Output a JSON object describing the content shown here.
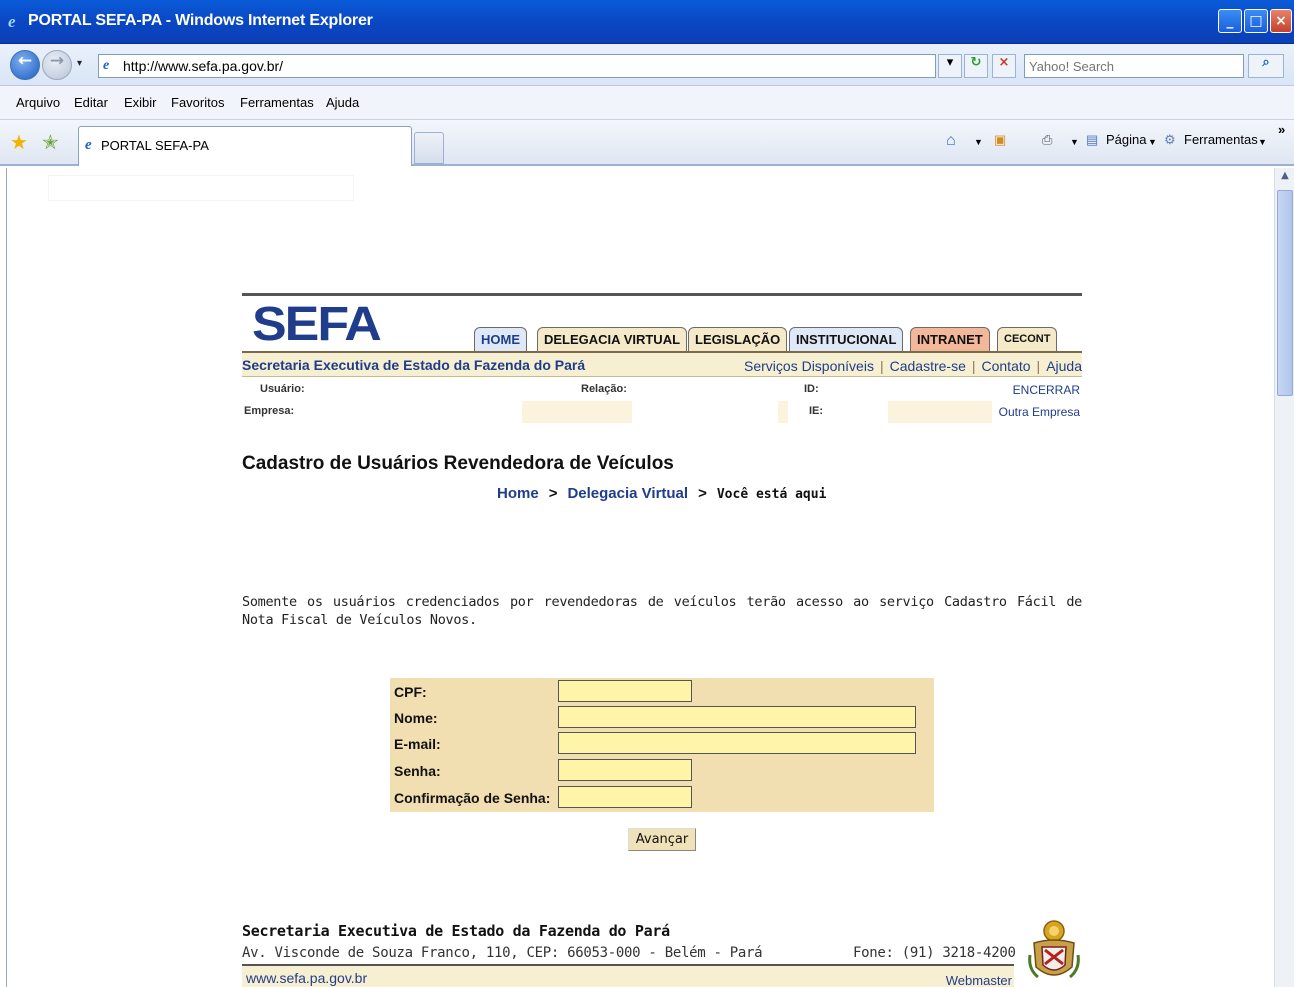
{
  "window": {
    "title": "PORTAL SEFA-PA - Windows Internet Explorer",
    "controls": {
      "minimize": "_",
      "maximize": "□",
      "close": "×"
    }
  },
  "address_bar": {
    "url": "http://www.sefa.pa.gov.br/",
    "search_placeholder": "Yahoo! Search",
    "dropdown_glyph": "▾",
    "refresh_glyph": "↻",
    "stop_glyph": "×",
    "search_glyph": "⌕"
  },
  "menu": [
    "Arquivo",
    "Editar",
    "Exibir",
    "Favoritos",
    "Ferramentas",
    "Ajuda"
  ],
  "favorites_bar": {
    "tab_title": "PORTAL SEFA-PA",
    "commands": {
      "page": "Página",
      "tools": "Ferramentas",
      "more": "»"
    }
  },
  "site": {
    "logo": "SEFA",
    "nav_tabs": [
      "HOME",
      "DELEGACIA VIRTUAL",
      "LEGISLAÇÃO",
      "INSTITUCIONAL",
      "INTRANET",
      "CECONT"
    ],
    "agency": "Secretaria Executiva de Estado da Fazenda do Pará",
    "header_links": [
      "Serviços Disponíveis",
      "Cadastre-se",
      "Contato",
      "Ajuda"
    ],
    "info": {
      "usuario_label": "Usuário:",
      "relacao_label": "Relação:",
      "id_label": "ID:",
      "encerrar": "ENCERRAR",
      "empresa_label": "Empresa:",
      "ie_label": "IE:",
      "outra_empresa": "Outra Empresa"
    },
    "page_title": "Cadastro de Usuários Revendedora de Veículos",
    "breadcrumb": {
      "home": "Home",
      "sep": ">",
      "delegacia": "Delegacia Virtual",
      "current": "Você está aqui"
    },
    "notice": "Somente os usuários credenciados por revendedoras de veículos terão acesso ao serviço Cadastro Fácil de Nota Fiscal de Veículos Novos.",
    "form": {
      "cpf_label": "CPF:",
      "nome_label": "Nome:",
      "email_label": "E-mail:",
      "senha_label": "Senha:",
      "confirm_label": "Confirmação de Senha:",
      "submit_label": "Avançar"
    },
    "footer": {
      "title": "Secretaria Executiva de Estado da Fazenda do Pará",
      "address": "Av. Visconde de Souza Franco, 110, CEP: 66053-000 - Belém - Pará",
      "phone": "Fone: (91) 3218-4200",
      "site": "www.sefa.pa.gov.br",
      "webmaster": "Webmaster"
    }
  },
  "colors": {
    "brand_blue": "#1f3d8a",
    "strip_beige": "#f7efd1",
    "form_bg": "#f1dfb2",
    "input_yellow": "#fff4a8",
    "intranet_tab": "#f3b79a",
    "tab_blue": "#dfe8f6",
    "tab_beige": "#f4e9c8"
  }
}
